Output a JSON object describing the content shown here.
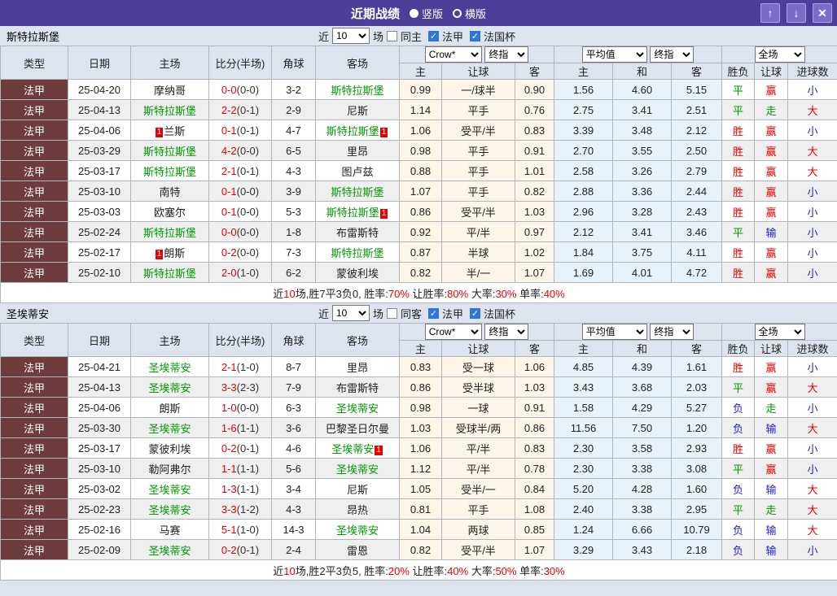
{
  "titlebar": {
    "title": "近期战绩",
    "radios": [
      {
        "label": "竖版",
        "selected": true
      },
      {
        "label": "横版",
        "selected": false
      }
    ],
    "buttons": {
      "up": "↑",
      "down": "↓",
      "close": "✕"
    }
  },
  "header": {
    "type": "类型",
    "date": "日期",
    "home": "主场",
    "score": "比分(半场)",
    "corner": "角球",
    "away": "客场",
    "select_crow": "Crow*",
    "select_final": "终指",
    "select_avg": "平均值",
    "select_full": "全场",
    "sub_home": "主",
    "sub_handicap": "让球",
    "sub_away": "客",
    "sub_avg_home": "主",
    "sub_draw": "和",
    "sub_avg_away": "客",
    "sub_result": "胜负",
    "sub_let": "让球",
    "sub_goals": "进球数"
  },
  "result_color_map": {
    "胜": "res-red",
    "平": "res-green",
    "负": "res-blue",
    "赢": "res-red",
    "走": "res-green",
    "输": "res-blue",
    "大": "res-red",
    "小": "res-blue"
  },
  "colors": {
    "titlebar_purple": "#4c3f99",
    "button_purple": "#7a6cc8",
    "type_maroon": "#6e3c3c",
    "team_green": "#009900",
    "win_red": "#e60000",
    "lose_blue": "#2222cc",
    "odds_cream": "#fcf5e8",
    "avg_blue": "#e7f2fa",
    "checkbox_blue": "#2e74d9"
  },
  "sections": [
    {
      "team": "斯特拉斯堡",
      "filters": {
        "near": "近",
        "count": "10",
        "games": "场",
        "same_label": "同主",
        "same_checked": false,
        "league_label": "法甲",
        "league_checked": true,
        "cup_label": "法国杯",
        "cup_checked": true
      },
      "rows": [
        {
          "type": "法甲",
          "date": "25-04-20",
          "home": {
            "name": "摩纳哥",
            "green": false
          },
          "score": {
            "ft": "0-0",
            "ht": "(0-0)"
          },
          "corners": "3-2",
          "away": {
            "name": "斯特拉斯堡",
            "green": true
          },
          "odds": [
            "0.99",
            "一/球半",
            "0.90"
          ],
          "avg": [
            "1.56",
            "4.60",
            "5.15"
          ],
          "results": [
            "平",
            "赢",
            "小"
          ]
        },
        {
          "type": "法甲",
          "date": "25-04-13",
          "home": {
            "name": "斯特拉斯堡",
            "green": true
          },
          "score": {
            "ft": "2-2",
            "ht": "(0-1)"
          },
          "corners": "2-9",
          "away": {
            "name": "尼斯",
            "green": false
          },
          "odds": [
            "1.14",
            "平手",
            "0.76"
          ],
          "avg": [
            "2.75",
            "3.41",
            "2.51"
          ],
          "results": [
            "平",
            "走",
            "大"
          ]
        },
        {
          "type": "法甲",
          "date": "25-04-06",
          "home": {
            "name": "兰斯",
            "green": false,
            "card_pre": "1"
          },
          "score": {
            "ft": "0-1",
            "ht": "(0-1)"
          },
          "corners": "4-7",
          "away": {
            "name": "斯特拉斯堡",
            "green": true,
            "card_post": "1"
          },
          "odds": [
            "1.06",
            "受平/半",
            "0.83"
          ],
          "avg": [
            "3.39",
            "3.48",
            "2.12"
          ],
          "results": [
            "胜",
            "赢",
            "小"
          ]
        },
        {
          "type": "法甲",
          "date": "25-03-29",
          "home": {
            "name": "斯特拉斯堡",
            "green": true
          },
          "score": {
            "ft": "4-2",
            "ht": "(0-0)"
          },
          "corners": "6-5",
          "away": {
            "name": "里昂",
            "green": false
          },
          "odds": [
            "0.98",
            "平手",
            "0.91"
          ],
          "avg": [
            "2.70",
            "3.55",
            "2.50"
          ],
          "results": [
            "胜",
            "赢",
            "大"
          ]
        },
        {
          "type": "法甲",
          "date": "25-03-17",
          "home": {
            "name": "斯特拉斯堡",
            "green": true
          },
          "score": {
            "ft": "2-1",
            "ht": "(0-1)"
          },
          "corners": "4-3",
          "away": {
            "name": "图卢兹",
            "green": false
          },
          "odds": [
            "0.88",
            "平手",
            "1.01"
          ],
          "avg": [
            "2.58",
            "3.26",
            "2.79"
          ],
          "results": [
            "胜",
            "赢",
            "大"
          ]
        },
        {
          "type": "法甲",
          "date": "25-03-10",
          "home": {
            "name": "南特",
            "green": false
          },
          "score": {
            "ft": "0-1",
            "ht": "(0-0)"
          },
          "corners": "3-9",
          "away": {
            "name": "斯特拉斯堡",
            "green": true
          },
          "odds": [
            "1.07",
            "平手",
            "0.82"
          ],
          "avg": [
            "2.88",
            "3.36",
            "2.44"
          ],
          "results": [
            "胜",
            "赢",
            "小"
          ]
        },
        {
          "type": "法甲",
          "date": "25-03-03",
          "home": {
            "name": "欧塞尔",
            "green": false
          },
          "score": {
            "ft": "0-1",
            "ht": "(0-0)"
          },
          "corners": "5-3",
          "away": {
            "name": "斯特拉斯堡",
            "green": true,
            "card_post": "1"
          },
          "odds": [
            "0.86",
            "受平/半",
            "1.03"
          ],
          "avg": [
            "2.96",
            "3.28",
            "2.43"
          ],
          "results": [
            "胜",
            "赢",
            "小"
          ]
        },
        {
          "type": "法甲",
          "date": "25-02-24",
          "home": {
            "name": "斯特拉斯堡",
            "green": true
          },
          "score": {
            "ft": "0-0",
            "ht": "(0-0)"
          },
          "corners": "1-8",
          "away": {
            "name": "布雷斯特",
            "green": false
          },
          "odds": [
            "0.92",
            "平/半",
            "0.97"
          ],
          "avg": [
            "2.12",
            "3.41",
            "3.46"
          ],
          "results": [
            "平",
            "输",
            "小"
          ]
        },
        {
          "type": "法甲",
          "date": "25-02-17",
          "home": {
            "name": "朗斯",
            "green": false,
            "card_pre": "1"
          },
          "score": {
            "ft": "0-2",
            "ht": "(0-0)"
          },
          "corners": "7-3",
          "away": {
            "name": "斯特拉斯堡",
            "green": true
          },
          "odds": [
            "0.87",
            "半球",
            "1.02"
          ],
          "avg": [
            "1.84",
            "3.75",
            "4.11"
          ],
          "results": [
            "胜",
            "赢",
            "小"
          ]
        },
        {
          "type": "法甲",
          "date": "25-02-10",
          "home": {
            "name": "斯特拉斯堡",
            "green": true
          },
          "score": {
            "ft": "2-0",
            "ht": "(1-0)"
          },
          "corners": "6-2",
          "away": {
            "name": "蒙彼利埃",
            "green": false
          },
          "odds": [
            "0.82",
            "半/一",
            "1.07"
          ],
          "avg": [
            "1.69",
            "4.01",
            "4.72"
          ],
          "results": [
            "胜",
            "赢",
            "小"
          ]
        }
      ],
      "summary": [
        {
          "t": "近"
        },
        {
          "t": "10",
          "red": true
        },
        {
          "t": "场,胜7平3负0, 胜率:"
        },
        {
          "t": "70%",
          "red": true
        },
        {
          "t": " 让胜率:"
        },
        {
          "t": "80%",
          "red": true
        },
        {
          "t": " 大率:"
        },
        {
          "t": "30%",
          "red": true
        },
        {
          "t": " 单率:"
        },
        {
          "t": "40%",
          "red": true
        }
      ]
    },
    {
      "team": "圣埃蒂安",
      "filters": {
        "near": "近",
        "count": "10",
        "games": "场",
        "same_label": "同客",
        "same_checked": false,
        "league_label": "法甲",
        "league_checked": true,
        "cup_label": "法国杯",
        "cup_checked": true
      },
      "rows": [
        {
          "type": "法甲",
          "date": "25-04-21",
          "home": {
            "name": "圣埃蒂安",
            "green": true
          },
          "score": {
            "ft": "2-1",
            "ht": "(1-0)"
          },
          "corners": "8-7",
          "away": {
            "name": "里昂",
            "green": false
          },
          "odds": [
            "0.83",
            "受一球",
            "1.06"
          ],
          "avg": [
            "4.85",
            "4.39",
            "1.61"
          ],
          "results": [
            "胜",
            "赢",
            "小"
          ]
        },
        {
          "type": "法甲",
          "date": "25-04-13",
          "home": {
            "name": "圣埃蒂安",
            "green": true
          },
          "score": {
            "ft": "3-3",
            "ht": "(2-3)"
          },
          "corners": "7-9",
          "away": {
            "name": "布雷斯特",
            "green": false
          },
          "odds": [
            "0.86",
            "受半球",
            "1.03"
          ],
          "avg": [
            "3.43",
            "3.68",
            "2.03"
          ],
          "results": [
            "平",
            "赢",
            "大"
          ]
        },
        {
          "type": "法甲",
          "date": "25-04-06",
          "home": {
            "name": "朗斯",
            "green": false
          },
          "score": {
            "ft": "1-0",
            "ht": "(0-0)"
          },
          "corners": "6-3",
          "away": {
            "name": "圣埃蒂安",
            "green": true
          },
          "odds": [
            "0.98",
            "一球",
            "0.91"
          ],
          "avg": [
            "1.58",
            "4.29",
            "5.27"
          ],
          "results": [
            "负",
            "走",
            "小"
          ]
        },
        {
          "type": "法甲",
          "date": "25-03-30",
          "home": {
            "name": "圣埃蒂安",
            "green": true
          },
          "score": {
            "ft": "1-6",
            "ht": "(1-1)"
          },
          "corners": "3-6",
          "away": {
            "name": "巴黎圣日尔曼",
            "green": false
          },
          "odds": [
            "1.03",
            "受球半/两",
            "0.86"
          ],
          "avg": [
            "11.56",
            "7.50",
            "1.20"
          ],
          "results": [
            "负",
            "输",
            "大"
          ]
        },
        {
          "type": "法甲",
          "date": "25-03-17",
          "home": {
            "name": "蒙彼利埃",
            "green": false
          },
          "score": {
            "ft": "0-2",
            "ht": "(0-1)"
          },
          "corners": "4-6",
          "away": {
            "name": "圣埃蒂安",
            "green": true,
            "card_post": "1"
          },
          "odds": [
            "1.06",
            "平/半",
            "0.83"
          ],
          "avg": [
            "2.30",
            "3.58",
            "2.93"
          ],
          "results": [
            "胜",
            "赢",
            "小"
          ]
        },
        {
          "type": "法甲",
          "date": "25-03-10",
          "home": {
            "name": "勒阿弗尔",
            "green": false
          },
          "score": {
            "ft": "1-1",
            "ht": "(1-1)"
          },
          "corners": "5-6",
          "away": {
            "name": "圣埃蒂安",
            "green": true
          },
          "odds": [
            "1.12",
            "平/半",
            "0.78"
          ],
          "avg": [
            "2.30",
            "3.38",
            "3.08"
          ],
          "results": [
            "平",
            "赢",
            "小"
          ]
        },
        {
          "type": "法甲",
          "date": "25-03-02",
          "home": {
            "name": "圣埃蒂安",
            "green": true
          },
          "score": {
            "ft": "1-3",
            "ht": "(1-1)"
          },
          "corners": "3-4",
          "away": {
            "name": "尼斯",
            "green": false
          },
          "odds": [
            "1.05",
            "受半/一",
            "0.84"
          ],
          "avg": [
            "5.20",
            "4.28",
            "1.60"
          ],
          "results": [
            "负",
            "输",
            "大"
          ]
        },
        {
          "type": "法甲",
          "date": "25-02-23",
          "home": {
            "name": "圣埃蒂安",
            "green": true
          },
          "score": {
            "ft": "3-3",
            "ht": "(1-2)"
          },
          "corners": "4-3",
          "away": {
            "name": "昂热",
            "green": false
          },
          "odds": [
            "0.81",
            "平手",
            "1.08"
          ],
          "avg": [
            "2.40",
            "3.38",
            "2.95"
          ],
          "results": [
            "平",
            "走",
            "大"
          ]
        },
        {
          "type": "法甲",
          "date": "25-02-16",
          "home": {
            "name": "马赛",
            "green": false
          },
          "score": {
            "ft": "5-1",
            "ht": "(1-0)"
          },
          "corners": "14-3",
          "away": {
            "name": "圣埃蒂安",
            "green": true
          },
          "odds": [
            "1.04",
            "两球",
            "0.85"
          ],
          "avg": [
            "1.24",
            "6.66",
            "10.79"
          ],
          "results": [
            "负",
            "输",
            "大"
          ]
        },
        {
          "type": "法甲",
          "date": "25-02-09",
          "home": {
            "name": "圣埃蒂安",
            "green": true
          },
          "score": {
            "ft": "0-2",
            "ht": "(0-1)"
          },
          "corners": "2-4",
          "away": {
            "name": "雷恩",
            "green": false
          },
          "odds": [
            "0.82",
            "受平/半",
            "1.07"
          ],
          "avg": [
            "3.29",
            "3.43",
            "2.18"
          ],
          "results": [
            "负",
            "输",
            "小"
          ]
        }
      ],
      "summary": [
        {
          "t": "近"
        },
        {
          "t": "10",
          "red": true
        },
        {
          "t": "场,胜2平3负5, 胜率:"
        },
        {
          "t": "20%",
          "red": true
        },
        {
          "t": " 让胜率:"
        },
        {
          "t": "40%",
          "red": true
        },
        {
          "t": " 大率:"
        },
        {
          "t": "50%",
          "red": true
        },
        {
          "t": " 单率:"
        },
        {
          "t": "30%",
          "red": true
        }
      ]
    }
  ]
}
